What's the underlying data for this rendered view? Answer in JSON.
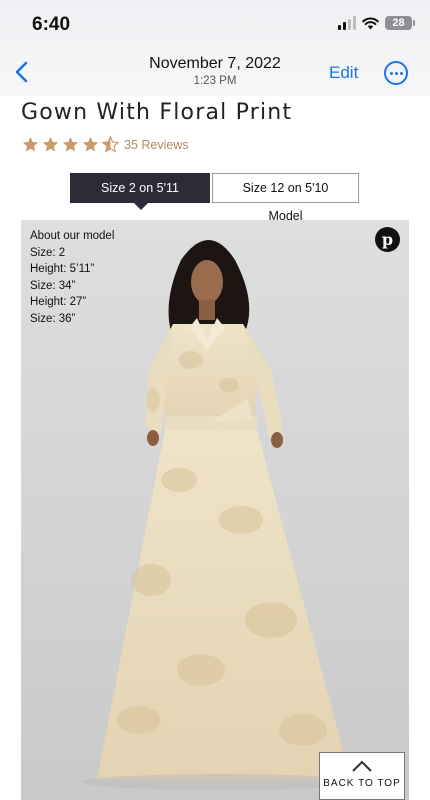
{
  "status_bar": {
    "time": "6:40",
    "battery": "28"
  },
  "nav": {
    "date": "November 7, 2022",
    "time": "1:23 PM",
    "edit_label": "Edit"
  },
  "product": {
    "title": "Gown With Floral Print",
    "rating": 4.5,
    "reviews_label": "35 Reviews",
    "size_options": [
      "Size 2 on 5'11 Model",
      "Size 12 on 5'10 Model"
    ],
    "selected_size_option": "Size 2 on 5'11 Model"
  },
  "model_info": {
    "heading": "About our model",
    "lines": [
      "Size: 2",
      "Height: 5’11”",
      "Size: 34”",
      "Height: 27”",
      "Size: 36”"
    ]
  },
  "back_to_top_label": "BACK TO TOP",
  "colors": {
    "link_blue": "#1a73e8",
    "star_tan": "#c9996a",
    "active_toggle": "#2b2c38"
  },
  "icons": [
    "back-chevron-icon",
    "more-icon",
    "star-icon",
    "pinterest-icon",
    "chevron-up-icon"
  ]
}
